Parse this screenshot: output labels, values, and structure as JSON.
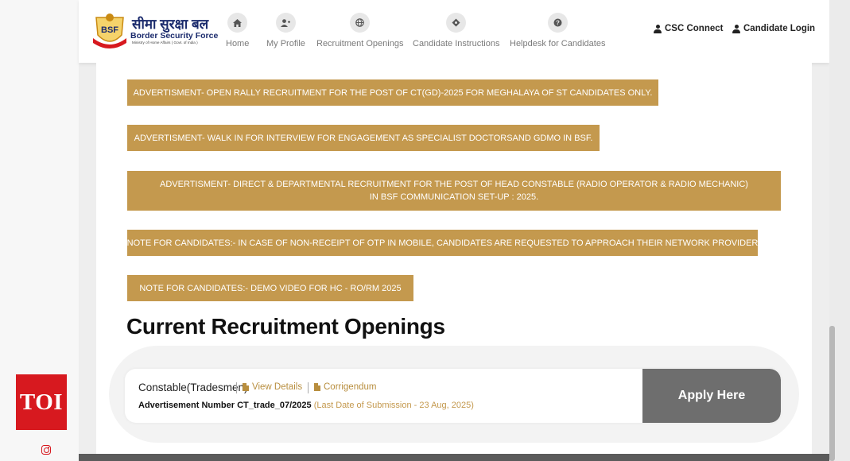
{
  "overlay": {
    "toi_logo": "TOI",
    "social_icon": "instagram-icon"
  },
  "logo": {
    "hindi": "सीमा सुरक्षा बल",
    "english": "Border Security Force",
    "sub": "Ministry of Home Affairs ( Govt. of India )",
    "badge": "BSF"
  },
  "nav": {
    "items": [
      {
        "label": "Home",
        "icon": "home-icon"
      },
      {
        "label": "My Profile",
        "icon": "user-add-icon"
      },
      {
        "label": "Recruitment Openings",
        "icon": "globe-icon"
      },
      {
        "label": "Candidate Instructions",
        "icon": "compass-icon"
      },
      {
        "label": "Helpdesk for Candidates",
        "icon": "question-icon"
      }
    ]
  },
  "header_links": {
    "csc": "CSC Connect",
    "login": "Candidate Login"
  },
  "notices": [
    "ADVERTISMENT- OPEN RALLY RECRUITMENT FOR THE POST OF CT(GD)-2025 FOR MEGHALAYA OF ST CANDIDATES ONLY.",
    "ADVERTISMENT- WALK IN FOR INTERVIEW FOR ENGAGEMENT AS SPECIALIST DOCTORSAND GDMO IN BSF.",
    "ADVERTISMENT- DIRECT & DEPARTMENTAL RECRUITMENT FOR THE POST OF HEAD CONSTABLE (RADIO OPERATOR & RADIO MECHANIC) IN BSF COMMUNICATION SET-UP : 2025.",
    "NOTE FOR CANDIDATES:- IN CASE OF NON-RECEIPT OF OTP IN MOBILE, CANDIDATES ARE REQUESTED TO APPROACH THEIR NETWORK PROVIDER",
    "NOTE FOR CANDIDATES:- DEMO VIDEO FOR HC - RO/RM 2025"
  ],
  "openings": {
    "title": "Current Recruitment Openings",
    "items": [
      {
        "post": "Constable(Tradesmen)",
        "view_details": "View Details",
        "corrigendum": "Corrigendum",
        "adv_number": "Advertisement Number CT_trade_07/2025",
        "last_date": "(Last Date of Submission - 23 Aug, 2025)",
        "apply": "Apply Here"
      }
    ]
  },
  "colors": {
    "notice_bg": "#c4994e",
    "link": "#b88e3e",
    "apply_bg": "#6e6e6e",
    "brand_navy": "#1a2a6c",
    "toi_red": "#d7191f"
  }
}
